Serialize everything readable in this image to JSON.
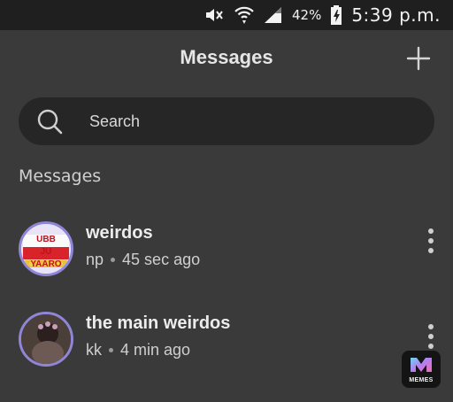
{
  "status_bar": {
    "battery": "42%",
    "time": "5:39 p.m."
  },
  "header": {
    "title": "Messages",
    "add_icon": "plus-icon"
  },
  "search": {
    "placeholder": "Search",
    "icon": "search-icon"
  },
  "section": {
    "label": "Messages"
  },
  "conversations": [
    {
      "name": "weirdos",
      "sender": "np",
      "time": "45 sec ago",
      "avatar_text": "UBB JU YAARO"
    },
    {
      "name": "the main weirdos",
      "sender": "kk",
      "time": "4 min ago"
    }
  ],
  "fab": {
    "label": "MEMES"
  },
  "colors": {
    "background": "#3a3a3a",
    "status_bar": "#1f1f1f",
    "search_bg": "#262626",
    "avatar_ring": "#8f86d8"
  }
}
